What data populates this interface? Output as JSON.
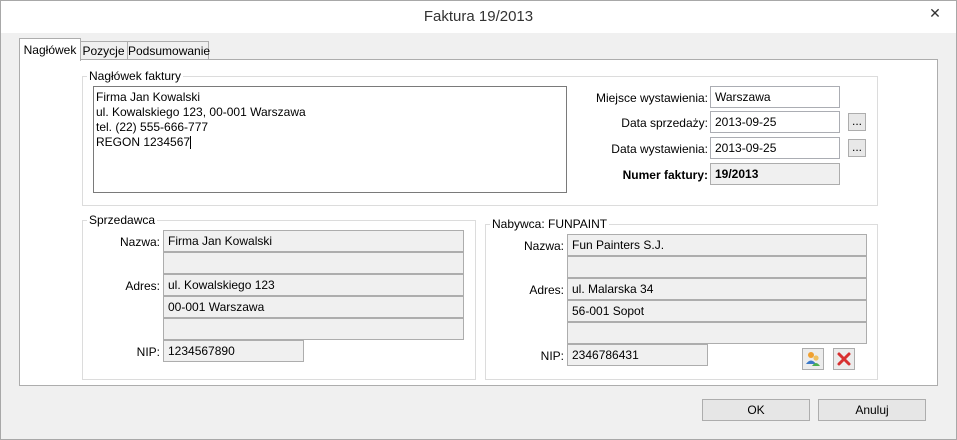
{
  "window": {
    "title": "Faktura 19/2013",
    "close_glyph": "✕"
  },
  "tabs": [
    {
      "label": "Nagłówek",
      "active": true
    },
    {
      "label": "Pozycje",
      "active": false
    },
    {
      "label": "Podsumowanie",
      "active": false
    }
  ],
  "header": {
    "group_title": "Nagłówek faktury",
    "text_lines": [
      "Firma Jan Kowalski",
      "ul. Kowalskiego 123, 00-001 Warszawa",
      "tel. (22) 555-666-777",
      "REGON 1234567"
    ],
    "place_label": "Miejsce wystawienia:",
    "place_value": "Warszawa",
    "sale_date_label": "Data sprzedaży:",
    "sale_date_value": "2013-09-25",
    "issue_date_label": "Data wystawienia:",
    "issue_date_value": "2013-09-25",
    "number_label": "Numer faktury:",
    "number_value": "19/2013",
    "picker_glyph": "..."
  },
  "seller": {
    "group_title": "Sprzedawca",
    "name_label": "Nazwa:",
    "name_lines": [
      "Firma Jan Kowalski",
      ""
    ],
    "address_label": "Adres:",
    "address_lines": [
      "ul. Kowalskiego 123",
      "00-001 Warszawa",
      ""
    ],
    "nip_label": "NIP:",
    "nip_value": "1234567890"
  },
  "buyer": {
    "group_title": "Nabywca: FUNPAINT",
    "name_label": "Nazwa:",
    "name_lines": [
      "Fun Painters S.J.",
      ""
    ],
    "address_label": "Adres:",
    "address_lines": [
      "ul. Malarska 34",
      "56-001 Sopot",
      ""
    ],
    "nip_label": "NIP:",
    "nip_value": "2346786431",
    "select_icon": "contacts-icon",
    "clear_icon": "delete-icon"
  },
  "footer": {
    "ok_label": "OK",
    "cancel_label": "Anuluj"
  },
  "colors": {
    "delete_red": "#d83030",
    "contacts_blue": "#3a78c8",
    "contacts_green": "#4caf50",
    "contacts_orange": "#f0a030"
  }
}
